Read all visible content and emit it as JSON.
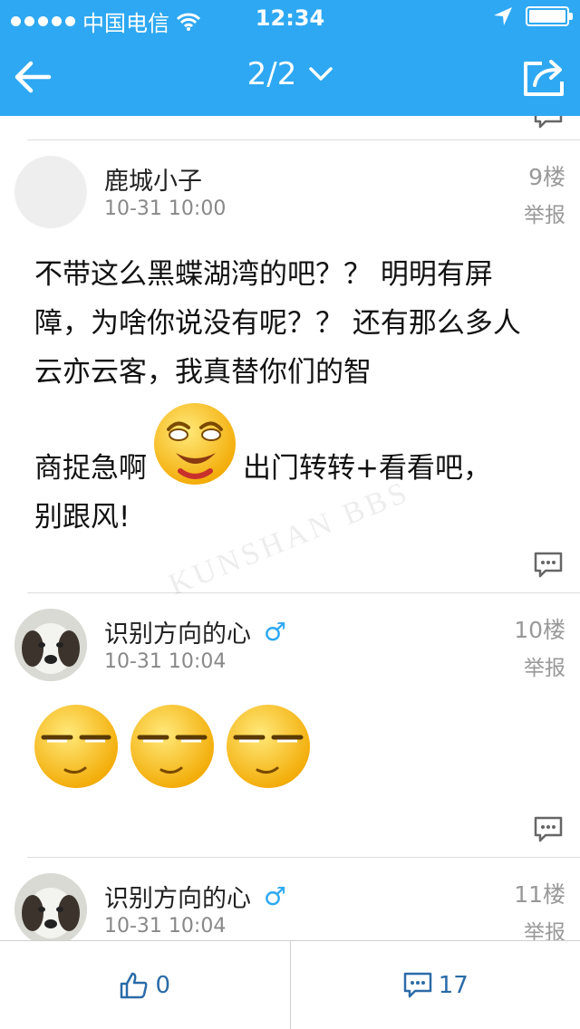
{
  "status_bar": {
    "carrier": "中国电信",
    "time": "12:34"
  },
  "nav": {
    "title": "2/2"
  },
  "posts": [
    {
      "author": "鹿城小子",
      "time": "10-31 10:00",
      "floor": "9楼",
      "report": "举报",
      "text_1": "不带这么黑蝶湖湾的吧？？ 明明有屏障，为啥你说没有呢？？ 还有那么多人云亦云客，我真替你们的智",
      "text_2": "商捉急啊",
      "text_3": "出门转转+看看吧，",
      "text_4": "别跟风!"
    },
    {
      "author": "识别方向的心",
      "gender_symbol": "♂",
      "time": "10-31 10:04",
      "floor": "10楼",
      "report": "举报"
    },
    {
      "author": "识别方向的心",
      "gender_symbol": "♂",
      "time": "10-31 10:04",
      "floor": "11楼",
      "report": "举报"
    }
  ],
  "watermark": "KUNSHAN BBS",
  "bottom_bar": {
    "like_count": "0",
    "comment_count": "17"
  },
  "colors": {
    "accent": "#2ea8f2",
    "bottom_text": "#2b6ba8"
  },
  "icons": [
    "back-arrow-icon",
    "chevron-down-icon",
    "share-icon",
    "wifi-icon",
    "location-icon",
    "battery-icon",
    "reply-bubble-icon",
    "thumbs-up-icon",
    "comment-icon",
    "laughing-emoji-icon",
    "smug-emoji-icon"
  ]
}
